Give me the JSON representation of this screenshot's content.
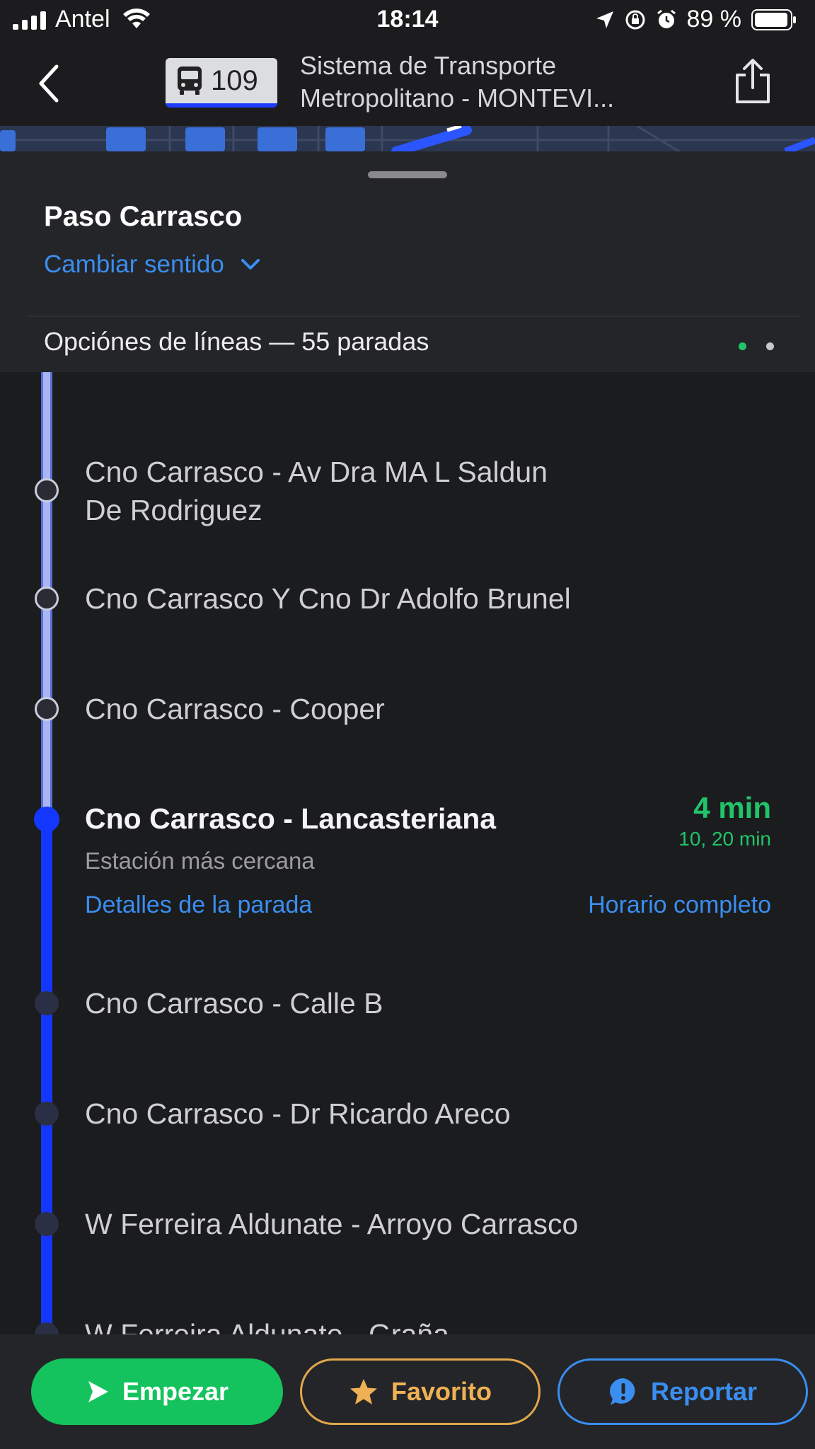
{
  "status_bar": {
    "carrier": "Antel",
    "time": "18:14",
    "battery": "89 %"
  },
  "header": {
    "route_number": "109",
    "agency_line1": "Sistema de Transporte",
    "agency_line2": "Metropolitano - MONTEVI..."
  },
  "sheet": {
    "stop_title": "Paso Carrasco",
    "change_direction": "Cambiar sentido",
    "line_options": "Opciónes de líneas — 55 paradas"
  },
  "stops": [
    {
      "line1": "Cno Carrasco - Av Dra MA L Saldun",
      "line2": "De Rodriguez"
    },
    {
      "line1": "Cno Carrasco Y Cno Dr Adolfo Brunel"
    },
    {
      "line1": "Cno Carrasco - Cooper"
    },
    {
      "line1": "Cno Carrasco - Lancasteriana"
    },
    {
      "line1": "Cno Carrasco - Calle B"
    },
    {
      "line1": "Cno Carrasco - Dr Ricardo Areco"
    },
    {
      "line1": "W Ferreira Aldunate - Arroyo Carrasco"
    },
    {
      "line1": "W Ferreira Aldunate - Graña"
    }
  ],
  "current_stop": {
    "subtitle": "Estación más cercana",
    "eta_main": "4 min",
    "eta_next": "10, 20 min",
    "details_link": "Detalles de la parada",
    "schedule_link": "Horario completo"
  },
  "actions": {
    "start": "Empezar",
    "favorite": "Favorito",
    "report": "Reportar"
  },
  "colors": {
    "accent_blue": "#3a8ef0",
    "route_blue": "#1437ff",
    "eta_green": "#21c46a",
    "start_green": "#14c35d",
    "favorite_gold": "#f0b154"
  }
}
